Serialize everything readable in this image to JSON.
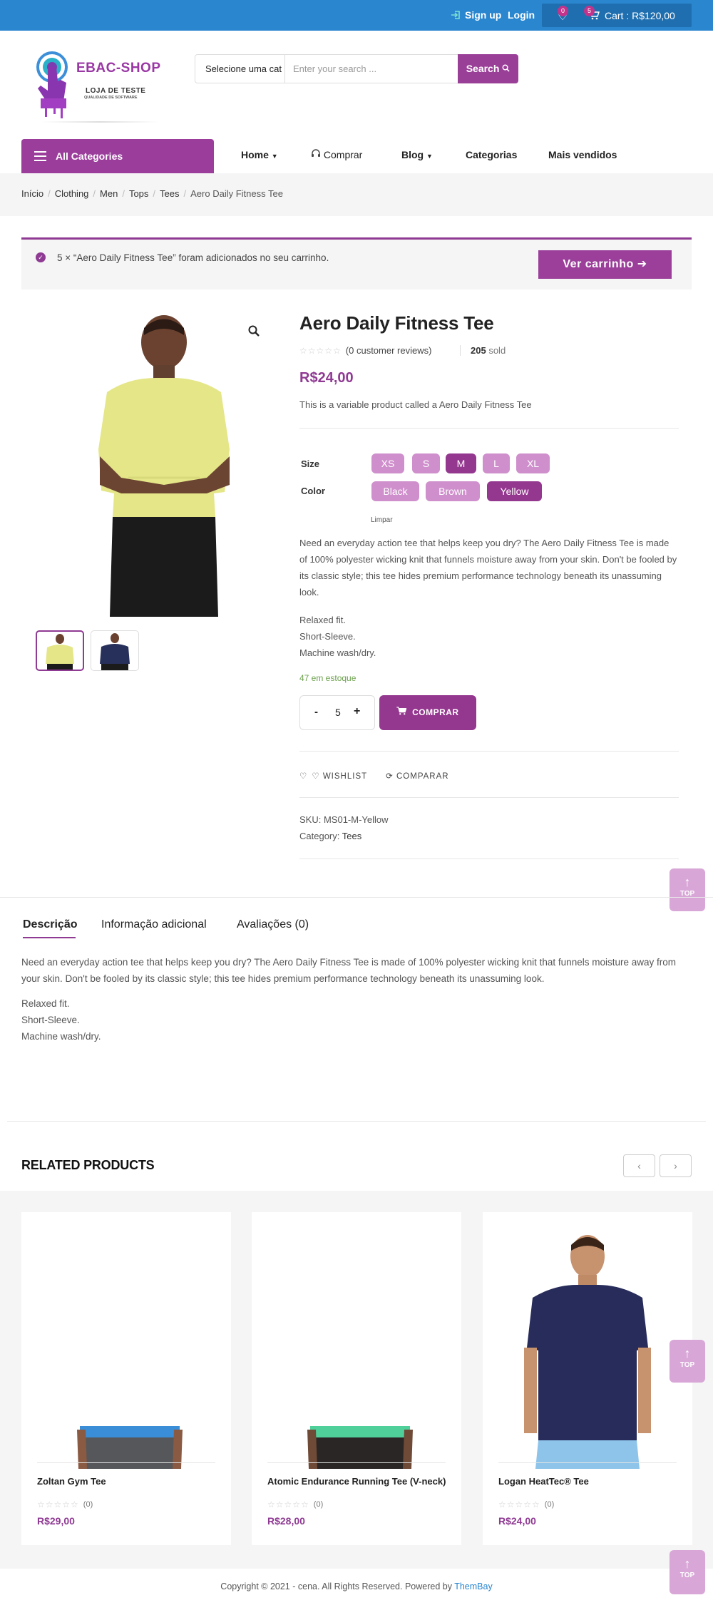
{
  "topbar": {
    "signup": "Sign up",
    "login": "Login",
    "wishlist_count": "0",
    "cart_count": "5",
    "cart_label": "Cart : R$120,00"
  },
  "brand": {
    "name": "EBAC-SHOP",
    "tagline": "LOJA DE TESTE",
    "subtagline": "QUALIDADE DE SOFTWARE"
  },
  "search": {
    "category": "Selecione uma cat",
    "placeholder": "Enter your search ...",
    "button": "Search"
  },
  "nav": {
    "all_categories": "All Categories",
    "items": [
      "Home",
      "Comprar",
      "Blog",
      "Categorias",
      "Mais vendidos"
    ]
  },
  "breadcrumb": [
    "Início",
    "Clothing",
    "Men",
    "Tops",
    "Tees",
    "Aero Daily Fitness Tee"
  ],
  "notice": {
    "message": "5 × “Aero Daily Fitness Tee” foram adicionados no seu carrinho.",
    "button": "Ver carrinho"
  },
  "product": {
    "title": "Aero Daily Fitness Tee",
    "reviews": "(0 customer reviews)",
    "sold_count": "205",
    "sold_label": "sold",
    "price": "R$24,00",
    "short_description": "This is a variable product called a Aero Daily Fitness Tee",
    "size_label": "Size",
    "sizes": [
      "XS",
      "S",
      "M",
      "L",
      "XL"
    ],
    "selected_size": "M",
    "color_label": "Color",
    "colors": [
      "Black",
      "Brown",
      "Yellow"
    ],
    "selected_color": "Yellow",
    "clear": "Limpar",
    "description": "Need an everyday action tee that helps keep you dry? The Aero Daily Fitness Tee is made of 100% polyester wicking knit that funnels moisture away from your skin. Don't be fooled by its classic style; this tee hides premium performance technology beneath its unassuming look.",
    "features": [
      "Relaxed fit.",
      "Short-Sleeve.",
      "Machine wash/dry."
    ],
    "stock": "47 em estoque",
    "quantity": "5",
    "buy_button": "COMPRAR",
    "wishlist": "WISHLIST",
    "compare": "COMPARAR",
    "sku_label": "SKU:",
    "sku": "MS01-M-Yellow",
    "category_label": "Category:",
    "category": "Tees"
  },
  "tabs": {
    "items": [
      "Descrição",
      "Informação adicional",
      "Avaliações (0)"
    ],
    "active": "Descrição",
    "description": "Need an everyday action tee that helps keep you dry? The Aero Daily Fitness Tee is made of 100% polyester wicking knit that funnels moisture away from your skin. Don't be fooled by its classic style; this tee hides premium performance technology beneath its unassuming look.",
    "features": [
      "Relaxed fit.",
      "Short-Sleeve.",
      "Machine wash/dry."
    ]
  },
  "related": {
    "heading": "RELATED PRODUCTS",
    "products": [
      {
        "name": "Zoltan Gym Tee",
        "reviews": "(0)",
        "price": "R$29,00"
      },
      {
        "name": "Atomic Endurance Running Tee (V-neck)",
        "reviews": "(0)",
        "price": "R$28,00"
      },
      {
        "name": "Logan HeatTec® Tee",
        "reviews": "(0)",
        "price": "R$24,00"
      }
    ]
  },
  "totop": "TOP",
  "footer": {
    "copyright": "Copyright © 2021 - cena. All Rights Reserved. Powered by",
    "powered_by": "ThemBay"
  },
  "colors": {
    "topbar": "#2a86cf",
    "accent": "#94378f",
    "swatch": "#cf8fcc",
    "stock": "#6ba04c"
  }
}
